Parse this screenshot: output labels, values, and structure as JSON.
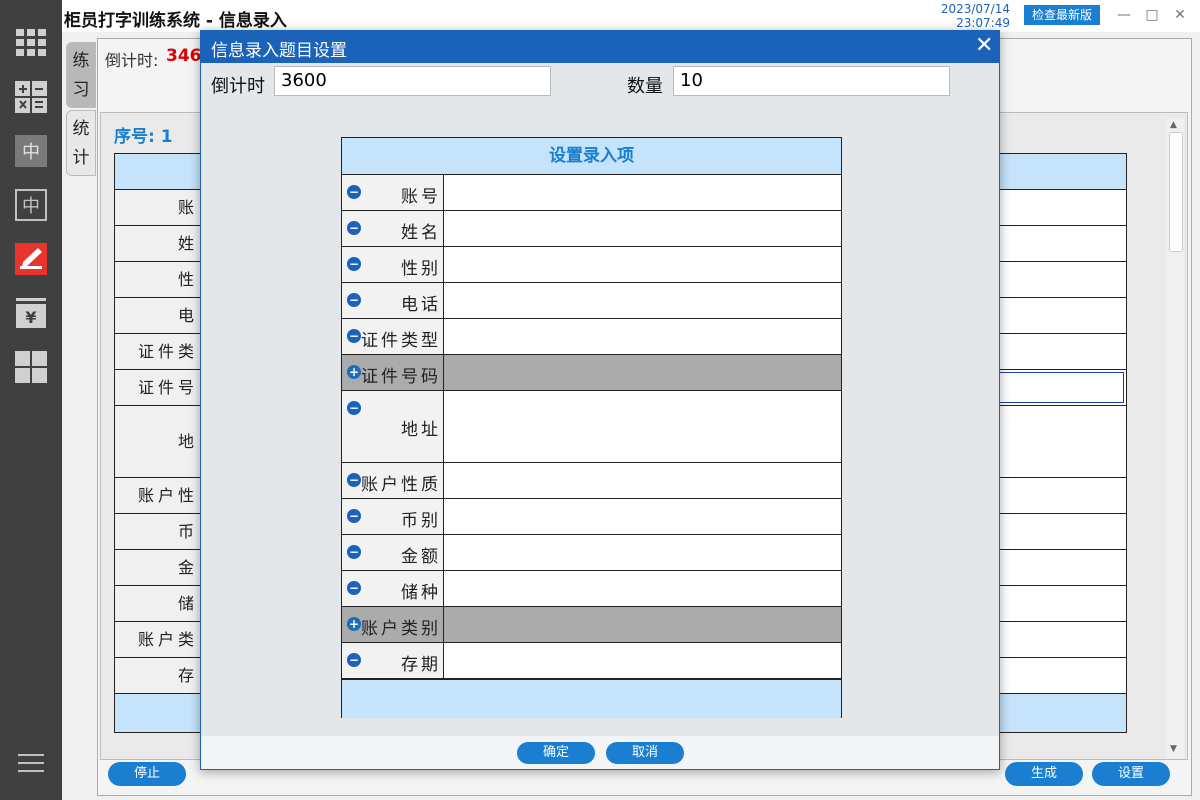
{
  "app": {
    "title": "柜员打字训练系统 - 信息录入",
    "date": "2023/07/14",
    "time": "23:07:49",
    "update_button": "检查最新版"
  },
  "window_controls": [
    "minimize-icon",
    "maximize-icon",
    "close-icon"
  ],
  "sidebar": {
    "items": [
      "grid-apps-icon",
      "calculator-icon",
      "chinese-char-filled-icon",
      "chinese-char-outline-icon",
      "edit-pen-icon",
      "yen-icon",
      "dashboard-icon",
      "menu-icon"
    ]
  },
  "tabs": [
    {
      "label_line1": "练",
      "label_line2": "习"
    },
    {
      "label_line1": "统",
      "label_line2": "计"
    }
  ],
  "main": {
    "countdown_label": "倒计时:",
    "countdown_value": "346",
    "sequence": "序号: 1",
    "background_labels": [
      "账",
      "姓",
      "性",
      "电",
      "证件类",
      "证件号",
      "地",
      "账户性",
      "币",
      "金",
      "储",
      "账户类",
      "存"
    ],
    "stop_button": "停止",
    "generate_button": "生成",
    "settings_button": "设置"
  },
  "dialog": {
    "title": "信息录入题目设置",
    "countdown_label": "倒计时",
    "countdown_value": "3600",
    "count_label": "数量",
    "count_value": "10",
    "table_header": "设置录入项",
    "items": [
      {
        "label": "账号",
        "enabled": true
      },
      {
        "label": "姓名",
        "enabled": true
      },
      {
        "label": "性别",
        "enabled": true
      },
      {
        "label": "电话",
        "enabled": true
      },
      {
        "label": "证件类型",
        "enabled": true
      },
      {
        "label": "证件号码",
        "enabled": false
      },
      {
        "label": "地址",
        "enabled": true
      },
      {
        "label": "账户性质",
        "enabled": true
      },
      {
        "label": "币别",
        "enabled": true
      },
      {
        "label": "金额",
        "enabled": true
      },
      {
        "label": "储种",
        "enabled": true
      },
      {
        "label": "账户类别",
        "enabled": false
      },
      {
        "label": "存期",
        "enabled": true
      }
    ],
    "ok_button": "确定",
    "cancel_button": "取消"
  },
  "colors": {
    "accent": "#1a7fd0",
    "dialog_title_bg": "#1a63b8",
    "countdown_red": "#e00000",
    "header_bg": "#c5e3fb",
    "disabled_row": "#ababab",
    "sidebar_bg": "#404040"
  }
}
